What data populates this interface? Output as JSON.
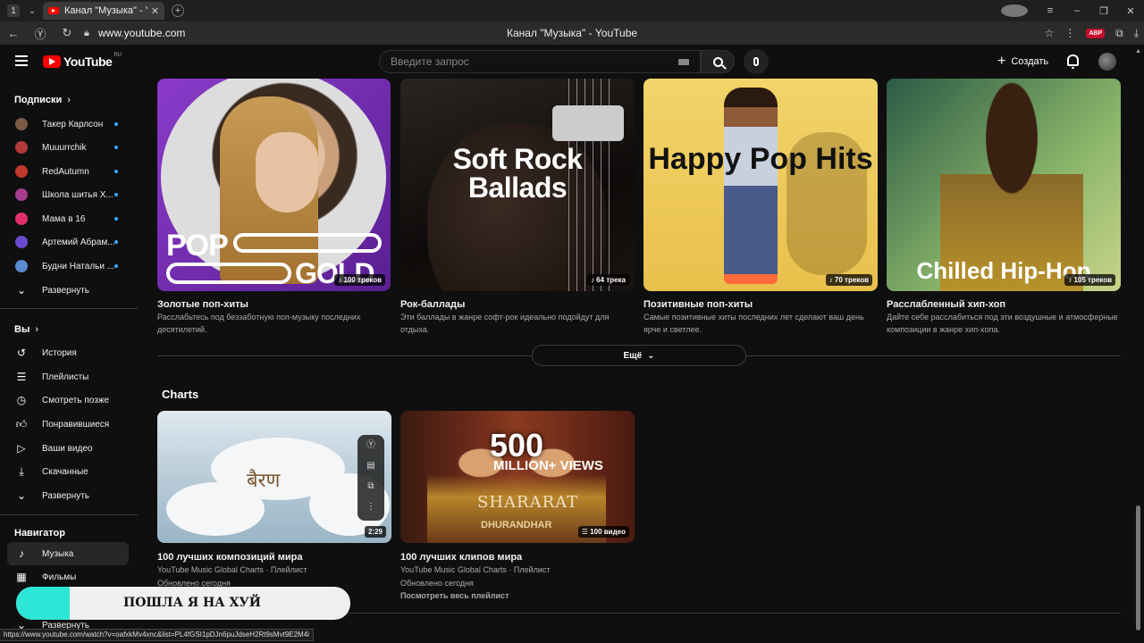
{
  "browser": {
    "tab_count": "1",
    "tab_title": "Канал \"Музыка\" - YouT",
    "address": "www.youtube.com",
    "page_title": "Канал \"Музыка\" - YouTube",
    "abp_label": "ABP"
  },
  "header": {
    "logo_text": "YouTube",
    "logo_region": "RU",
    "search_placeholder": "Введите запрос",
    "create_label": "Создать"
  },
  "sidebar": {
    "subscriptions_title": "Подписки",
    "channels": [
      {
        "name": "Такер Карлсон",
        "color": "#7a5a44"
      },
      {
        "name": "Muuurrchik",
        "color": "#b23a3a"
      },
      {
        "name": "RedAutumn",
        "color": "#c0392b"
      },
      {
        "name": "Школа шитья Х...",
        "color": "#a63c8f"
      },
      {
        "name": "Мама в 16",
        "color": "#e0306a"
      },
      {
        "name": "Артемий Абрам...",
        "color": "#6a4ad0"
      },
      {
        "name": "Будни Натальи ...",
        "color": "#5a8ad0"
      }
    ],
    "expand_label": "Развернуть",
    "you_title": "Вы",
    "you_items": [
      {
        "label": "История",
        "icon": "history-icon"
      },
      {
        "label": "Плейлисты",
        "icon": "playlists-icon"
      },
      {
        "label": "Смотреть позже",
        "icon": "watch-later-icon"
      },
      {
        "label": "Понравившиеся",
        "icon": "like-icon"
      },
      {
        "label": "Ваши видео",
        "icon": "your-videos-icon"
      },
      {
        "label": "Скачанные",
        "icon": "download-icon"
      }
    ],
    "expand_label_2": "Развернуть",
    "navigator_title": "Навигатор",
    "nav_items": [
      {
        "label": "Музыка",
        "icon": "music-icon",
        "active": true
      },
      {
        "label": "Фильмы",
        "icon": "film-icon",
        "active": false
      }
    ],
    "expand_label_3": "Развернуть"
  },
  "playlists": [
    {
      "title": "Золотые поп-хиты",
      "desc": "Расслабьтесь под беззаботную поп-музыку последних десятилетий.",
      "tracks": "100 треков",
      "thumb_text_1": "POP",
      "thumb_text_2": "GOLD"
    },
    {
      "title": "Рок-баллады",
      "desc": "Эти баллады в жанре софт-рок идеально подойдут для отдыха.",
      "tracks": "64 трека",
      "thumb_text": "Soft Rock Ballads"
    },
    {
      "title": "Позитивные поп-хиты",
      "desc": "Самые позитивные хиты последних лет сделают ваш день ярче и светлее.",
      "tracks": "70 треков",
      "thumb_text": "Happy Pop Hits"
    },
    {
      "title": "Расслабленный хип-хоп",
      "desc": "Дайте себе расслабиться под эти воздушные и атмосферные композиции в жанре хип-хопа.",
      "tracks": "105 треков",
      "thumb_text": "Chilled Hip-Hop"
    }
  ],
  "more_label": "Ещё",
  "charts_title": "Charts",
  "charts": [
    {
      "title": "100 лучших композиций мира",
      "channel": "YouTube Music Global Charts · Плейлист",
      "updated": "Обновлено сегодня",
      "badge": "2:29",
      "thumb_text": "बैरण"
    },
    {
      "title": "100 лучших клипов мира",
      "channel": "YouTube Music Global Charts · Плейлист",
      "updated": "Обновлено сегодня",
      "view_all": "Посмотреть весь плейлист",
      "badge": "100 видео",
      "thumb_big": "500",
      "thumb_mil": "MILLION+ VIEWS",
      "thumb_song": "SHARARAT",
      "thumb_film": "DHURANDHAR"
    }
  ],
  "overlay_text": "ПОШЛА Я НА ХУЙ",
  "overlay_progress": 0.16,
  "status_url": "https://www.youtube.com/watch?v=oafxkMv4xnc&list=PL4fGSI1pDJn6puJdseH2Rt9sMvt9E2M4i"
}
